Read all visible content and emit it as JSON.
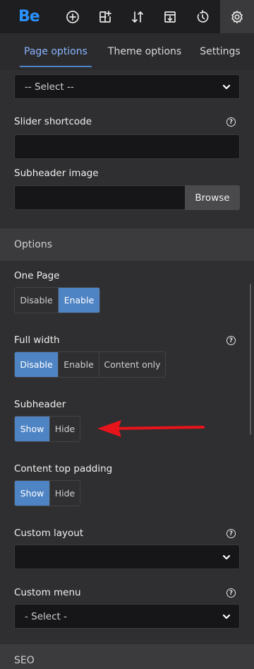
{
  "toolbar": {
    "logo": "Be",
    "icons": [
      "add-circle-icon",
      "add-section-icon",
      "sort-icon",
      "import-icon",
      "history-icon",
      "gear-icon"
    ]
  },
  "tabs": [
    {
      "label": "Page options",
      "active": true
    },
    {
      "label": "Theme options",
      "active": false
    },
    {
      "label": "Settings",
      "active": false
    }
  ],
  "fields": {
    "top_select": {
      "value": "-- Select --"
    },
    "slider_shortcode": {
      "label": "Slider shortcode",
      "value": ""
    },
    "subheader_image": {
      "label": "Subheader image",
      "value": "",
      "browse_label": "Browse"
    }
  },
  "sections": {
    "options": "Options",
    "seo": "SEO"
  },
  "options": {
    "one_page": {
      "label": "One Page",
      "choices": [
        "Disable",
        "Enable"
      ],
      "selected": "Enable"
    },
    "full_width": {
      "label": "Full width",
      "choices": [
        "Disable",
        "Enable",
        "Content only"
      ],
      "selected": "Disable"
    },
    "subheader": {
      "label": "Subheader",
      "choices": [
        "Show",
        "Hide"
      ],
      "selected": "Show"
    },
    "content_top_padding": {
      "label": "Content top padding",
      "choices": [
        "Show",
        "Hide"
      ],
      "selected": "Show"
    },
    "custom_layout": {
      "label": "Custom layout",
      "value": ""
    },
    "custom_menu": {
      "label": "Custom menu",
      "value": "- Select -"
    }
  },
  "colors": {
    "accent": "#4e84c4",
    "logo": "#2a92ff",
    "annotation_arrow": "#e8141b"
  }
}
